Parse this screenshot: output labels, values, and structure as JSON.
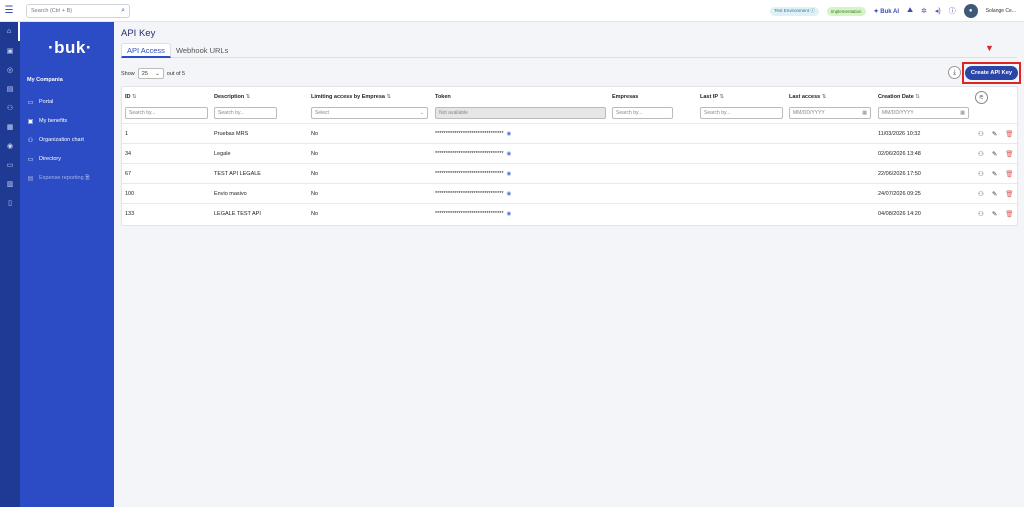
{
  "topbar": {
    "search_placeholder": "Search (Ctrl + B)",
    "env_badge": "Test Environment ⓘ",
    "impl_badge": "Implementation",
    "bukai": "✦ Buk AI",
    "user": "Solange Ce..."
  },
  "sidebar": {
    "logo": "·buk·",
    "company": "My Compania",
    "items": [
      {
        "label": "Portal",
        "icon": "portal-icon"
      },
      {
        "label": "My benefits",
        "icon": "gift-icon"
      },
      {
        "label": "Organization chart",
        "icon": "org-chart-icon"
      },
      {
        "label": "Directory",
        "icon": "folder-icon"
      },
      {
        "label": "Expense reporting 🗎",
        "icon": "receipt-icon"
      }
    ]
  },
  "main": {
    "title": "API Key",
    "tabs": [
      "API Access",
      "Webhook URLs"
    ],
    "show_label": "Show",
    "show_value": "25",
    "out_of": "out of 5",
    "create_label": "Create API Key"
  },
  "table": {
    "headers": {
      "id": "ID",
      "description": "Description",
      "limiting": "Limiting access by Empresa",
      "token": "Token",
      "empresas": "Empresas",
      "last_ip": "Last IP",
      "last_access": "Last access",
      "creation": "Creation Date"
    },
    "filters": {
      "search": "Search by...",
      "select": "Select",
      "not_available": "Not available",
      "date": "MM/DD/YYYY"
    },
    "rows": [
      {
        "id": "1",
        "description": "Pruebas MRS",
        "limiting": "No",
        "token": "********************************",
        "creation": "11/03/2026 10:32"
      },
      {
        "id": "34",
        "description": "Legale",
        "limiting": "No",
        "token": "********************************",
        "creation": "02/06/2026 13:48"
      },
      {
        "id": "67",
        "description": "TEST API LEGALE",
        "limiting": "No",
        "token": "********************************",
        "creation": "22/06/2026 17:50"
      },
      {
        "id": "100",
        "description": "Envio masivo",
        "limiting": "No",
        "token": "********************************",
        "creation": "24/07/2026 09:25"
      },
      {
        "id": "133",
        "description": "LEGALE TEST API",
        "limiting": "No",
        "token": "********************************",
        "creation": "04/08/2026 14:20"
      }
    ]
  }
}
